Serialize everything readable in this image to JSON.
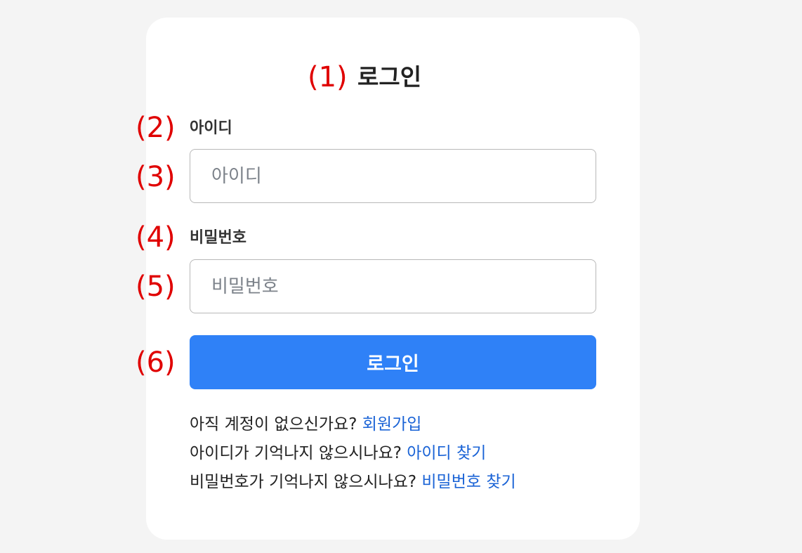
{
  "markers": [
    "(1)",
    "(2)",
    "(3)",
    "(4)",
    "(5)",
    "(6)"
  ],
  "login_form": {
    "title": "로그인",
    "username": {
      "label": "아이디",
      "placeholder": "아이디",
      "value": ""
    },
    "password": {
      "label": "비밀번호",
      "placeholder": "비밀번호",
      "value": ""
    },
    "submit_label": "로그인"
  },
  "helpers": [
    {
      "text": "아직 계정이 없으신가요?",
      "link": "회원가입"
    },
    {
      "text": "아이디가 기억나지 않으시나요?",
      "link": "아이디 찾기"
    },
    {
      "text": "비밀번호가 기억나지 않으시나요?",
      "link": "비밀번호 찾기"
    }
  ],
  "colors": {
    "primary_button": "#2f81f7",
    "link": "#1a63d6",
    "marker": "#e00000",
    "background": "#f4f4f4",
    "card": "#ffffff"
  }
}
